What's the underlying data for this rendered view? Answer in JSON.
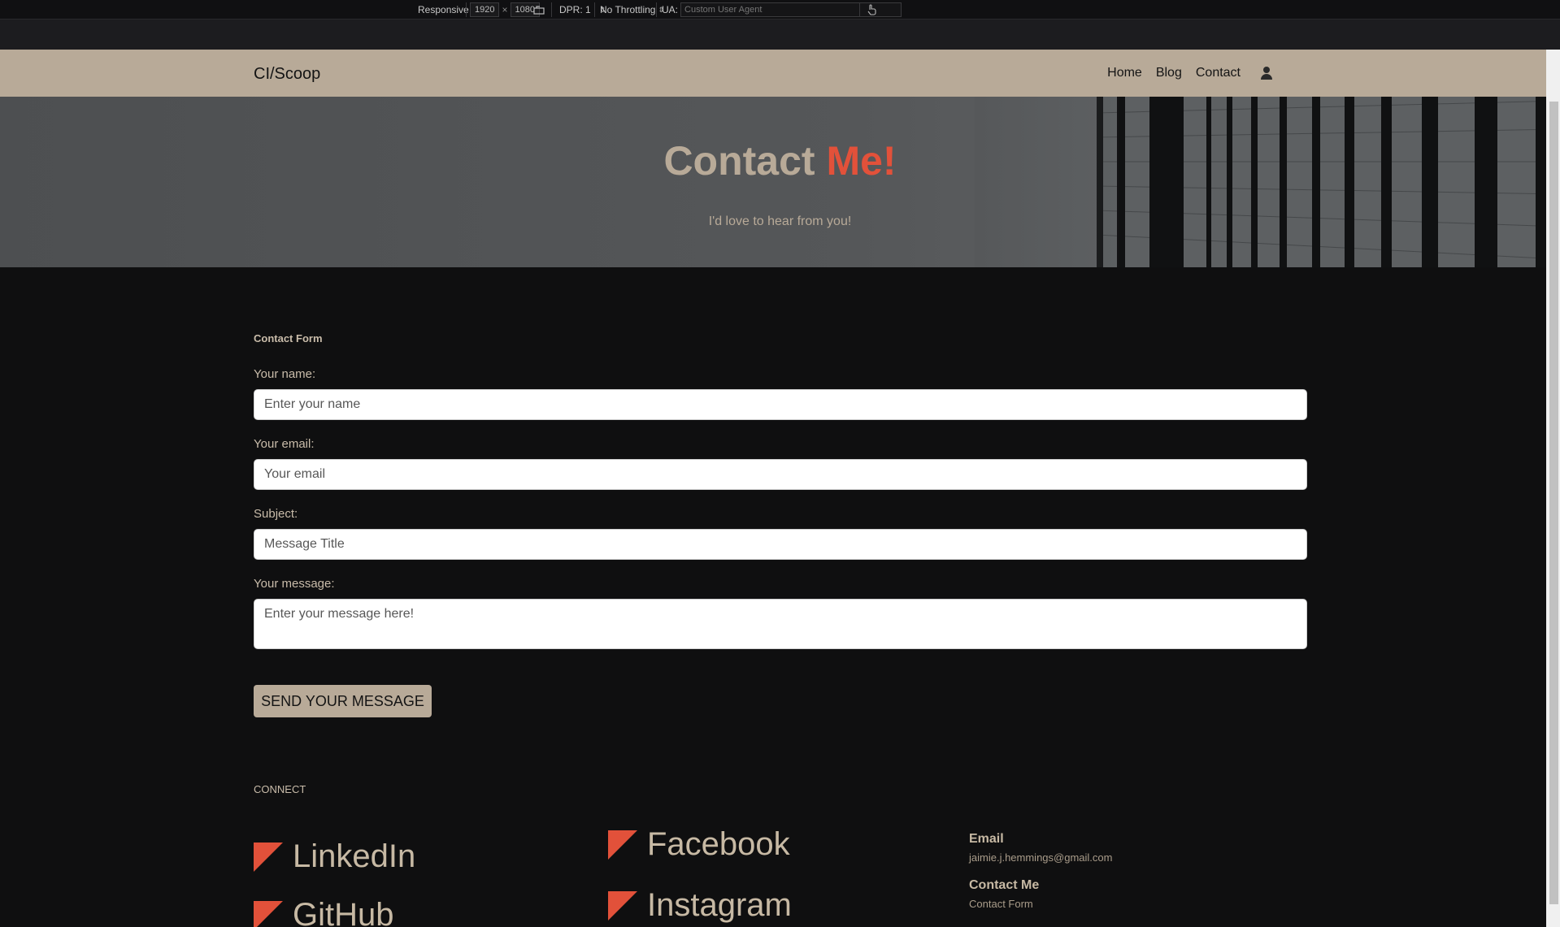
{
  "devtools": {
    "device": "Responsive",
    "width": "1920",
    "height": "1080",
    "dpr": "DPR: 1",
    "throttling": "No Throttling",
    "ua_label": "UA:",
    "ua_placeholder": "Custom User Agent"
  },
  "nav": {
    "brand": "CI/Scoop",
    "links": [
      "Home",
      "Blog",
      "Contact"
    ]
  },
  "hero": {
    "title_main": "Contact ",
    "title_accent": "Me!",
    "subtitle": "I'd love to hear from you!"
  },
  "form": {
    "heading": "Contact Form",
    "name_label": "Your name:",
    "name_placeholder": "Enter your name",
    "email_label": "Your email:",
    "email_placeholder": "Your email",
    "subject_label": "Subject:",
    "subject_placeholder": "Message Title",
    "message_label": "Your message:",
    "message_placeholder": "Enter your message here!",
    "submit": "SEND YOUR MESSAGE"
  },
  "footer": {
    "connect": "CONNECT",
    "socials": [
      "LinkedIn",
      "Facebook",
      "GitHub",
      "Instagram"
    ],
    "email_title": "Email",
    "email_value": "jaimie.j.hemmings@gmail.com",
    "contact_title": "Contact Me",
    "contact_value": "Contact Form"
  },
  "colors": {
    "accent": "#e2513a",
    "tan": "#b8aa98",
    "background": "#0f0f10"
  }
}
